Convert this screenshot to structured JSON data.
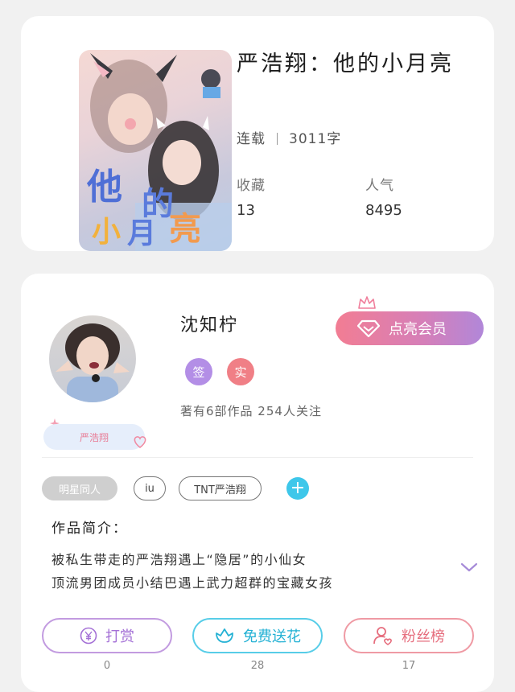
{
  "book": {
    "title": "严浩翔：他的小月亮",
    "status": "连载",
    "word_count": "3011字",
    "favorites_label": "收藏",
    "favorites_value": "13",
    "popularity_label": "人气",
    "popularity_value": "8495",
    "cover_text": "他的小月亮"
  },
  "author": {
    "name": "沈知柠",
    "vip_button": "点亮会员",
    "badge_sign": "签",
    "badge_real": "实",
    "works_info": "著有6部作品 254人关注",
    "fan_tag": "严浩翔"
  },
  "tags": [
    "明星同人",
    "iu",
    "TNT严浩翔"
  ],
  "intro": {
    "label": "作品简介：",
    "lines": [
      "被私生带走的严浩翔遇上“隐居”的小仙女",
      "顶流男团成员小结巴遇上武力超群的宝藏女孩"
    ]
  },
  "actions": [
    {
      "label": "打赏",
      "count": "0"
    },
    {
      "label": "免费送花",
      "count": "28"
    },
    {
      "label": "粉丝榜",
      "count": "17"
    }
  ],
  "colors": {
    "vip_gradient_start": "#f27d93",
    "vip_gradient_end": "#b187d9",
    "tip": "#a470d6",
    "flower": "#23b1d4",
    "fans": "#e66e7e"
  }
}
